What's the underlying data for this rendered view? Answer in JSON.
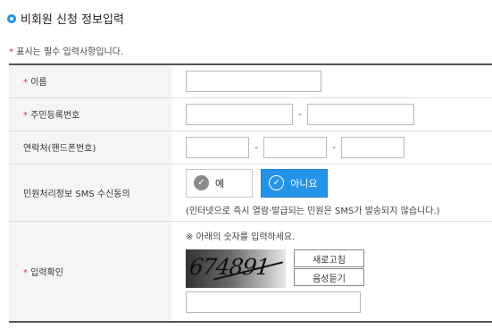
{
  "section_title": "비회원 신청 정보입력",
  "required_note": {
    "star": "*",
    "text": "표시는 필수 입력사항입니다."
  },
  "fields": {
    "name_label": "이름",
    "rrn_label": "주민등록번호",
    "phone_label": "연락처(핸드폰번호)",
    "sms_label": "민원처리정보 SMS 수신동의",
    "captcha_label": "입력확인"
  },
  "sms": {
    "yes_label": "예",
    "no_label": "아니요",
    "selected": "아니요",
    "check_glyph": "✓",
    "note": "(인터넷으로 즉시 열람·발급되는 민원은 SMS가 발송되지 않습니다.)"
  },
  "captcha": {
    "hint": "※ 아래의 숫자를 입력하세요.",
    "image_text": "674891",
    "refresh_label": "새로고침",
    "audio_label": "음성듣기"
  },
  "separators": {
    "dash": "-"
  },
  "colors": {
    "accent_blue": "#2593e8",
    "required_red": "#e8262f"
  }
}
